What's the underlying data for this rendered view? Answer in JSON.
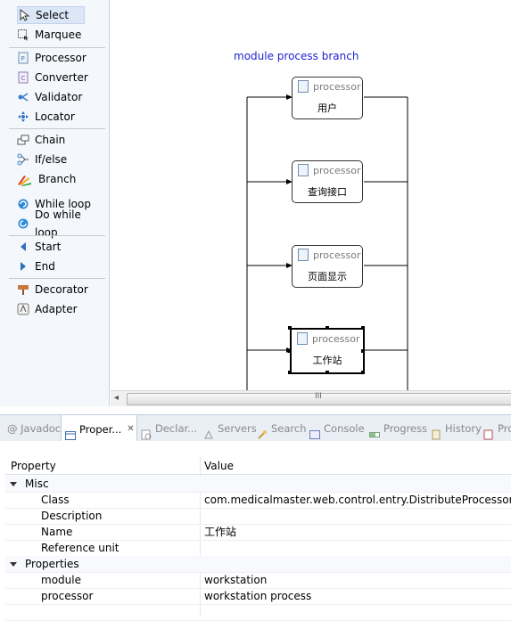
{
  "palette": {
    "items": [
      {
        "label": "Select",
        "icon": "cursor-arrow-icon"
      },
      {
        "label": "Marquee",
        "icon": "marquee-icon"
      },
      {
        "label": "Processor",
        "icon": "processor-icon"
      },
      {
        "label": "Converter",
        "icon": "converter-icon"
      },
      {
        "label": "Validator",
        "icon": "validator-icon"
      },
      {
        "label": "Locator",
        "icon": "locator-icon"
      },
      {
        "label": "Chain",
        "icon": "chain-icon"
      },
      {
        "label": "If/else",
        "icon": "if-else-icon"
      },
      {
        "label": "Branch",
        "icon": "branch-icon"
      },
      {
        "label": "While loop",
        "icon": "while-loop-icon"
      },
      {
        "label": "Do while loop",
        "icon": "do-while-loop-icon"
      },
      {
        "label": "Start",
        "icon": "start-arrow-icon"
      },
      {
        "label": "End",
        "icon": "end-arrow-icon"
      },
      {
        "label": "Decorator",
        "icon": "decorator-icon"
      },
      {
        "label": "Adapter",
        "icon": "adapter-icon"
      }
    ],
    "selected": "Select"
  },
  "diagram": {
    "title": "module process branch",
    "nodes": [
      {
        "type": "processor",
        "label": "用户",
        "selected": false
      },
      {
        "type": "processor",
        "label": "查询接口",
        "selected": false
      },
      {
        "type": "processor",
        "label": "页面显示",
        "selected": false
      },
      {
        "type": "processor",
        "label": "工作站",
        "selected": true
      }
    ],
    "scroll_grip": "III"
  },
  "view_tabs": [
    {
      "label": "@ Javadoc",
      "active": false
    },
    {
      "label": "Proper...",
      "active": true,
      "close": "✕"
    },
    {
      "label": "Declar...",
      "active": false
    },
    {
      "label": "Servers",
      "active": false
    },
    {
      "label": "Search",
      "active": false
    },
    {
      "label": "Console",
      "active": false
    },
    {
      "label": "Progress",
      "active": false
    },
    {
      "label": "History",
      "active": false
    },
    {
      "label": "Pro",
      "active": false
    }
  ],
  "properties": {
    "header": {
      "property": "Property",
      "value": "Value"
    },
    "groups": [
      {
        "name": "Misc",
        "rows": [
          {
            "property": "Class",
            "value": "com.medicalmaster.web.control.entry.DistributeProcessor"
          },
          {
            "property": "Description",
            "value": ""
          },
          {
            "property": "Name",
            "value": "工作站"
          },
          {
            "property": "Reference unit",
            "value": ""
          }
        ]
      },
      {
        "name": "Properties",
        "rows": [
          {
            "property": "module",
            "value": "workstation"
          },
          {
            "property": "processor",
            "value": "workstation process"
          }
        ]
      }
    ]
  },
  "colors": {
    "diagram_title": "#1f22d6",
    "palette_bg": "#f4f7fc",
    "selection_bg": "#dbe7f7"
  }
}
